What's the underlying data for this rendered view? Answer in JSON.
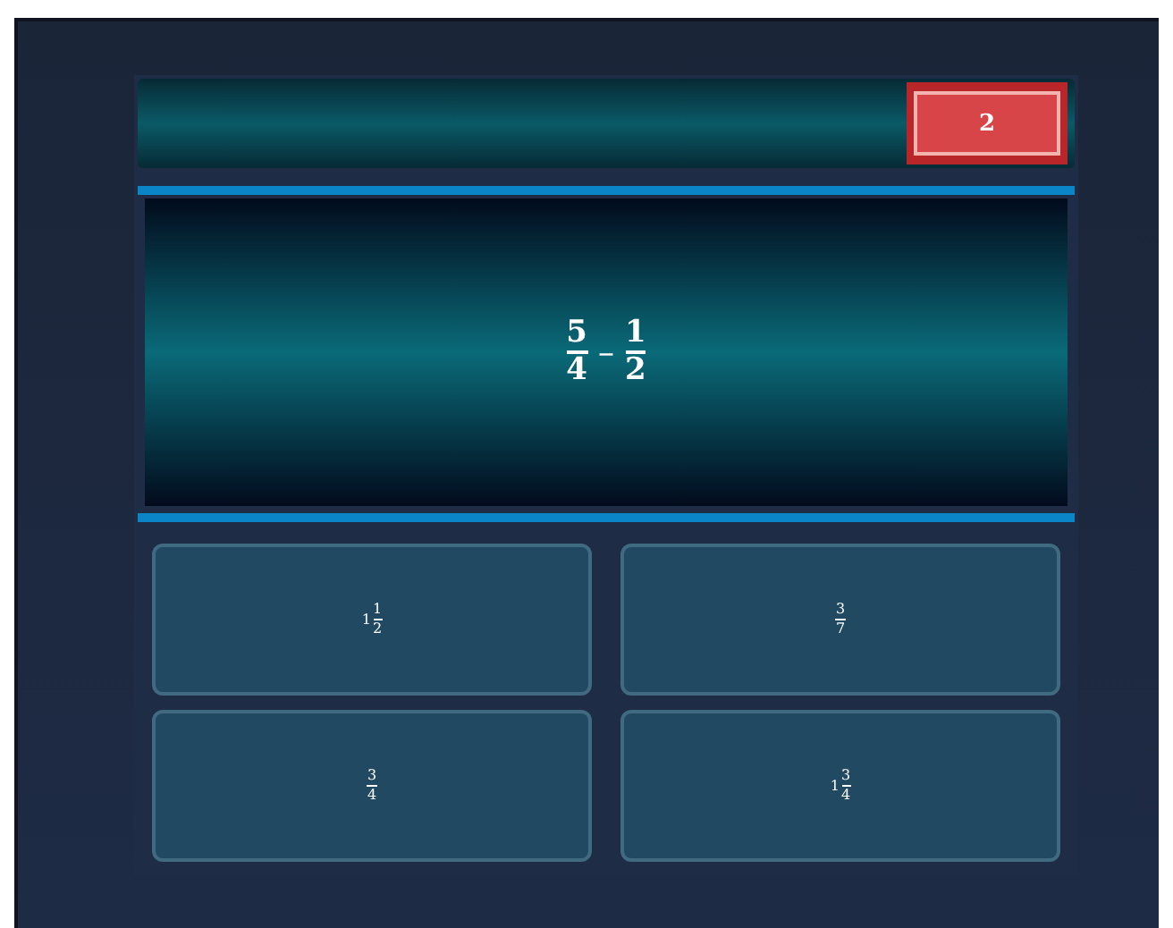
{
  "score": "2",
  "question": {
    "operator": "–",
    "terms": [
      {
        "num": "5",
        "den": "4"
      },
      {
        "num": "1",
        "den": "2"
      }
    ]
  },
  "answers": [
    {
      "whole": "1",
      "num": "1",
      "den": "2"
    },
    {
      "num": "3",
      "den": "7"
    },
    {
      "num": "3",
      "den": "4"
    },
    {
      "whole": "1",
      "num": "3",
      "den": "4"
    }
  ]
}
